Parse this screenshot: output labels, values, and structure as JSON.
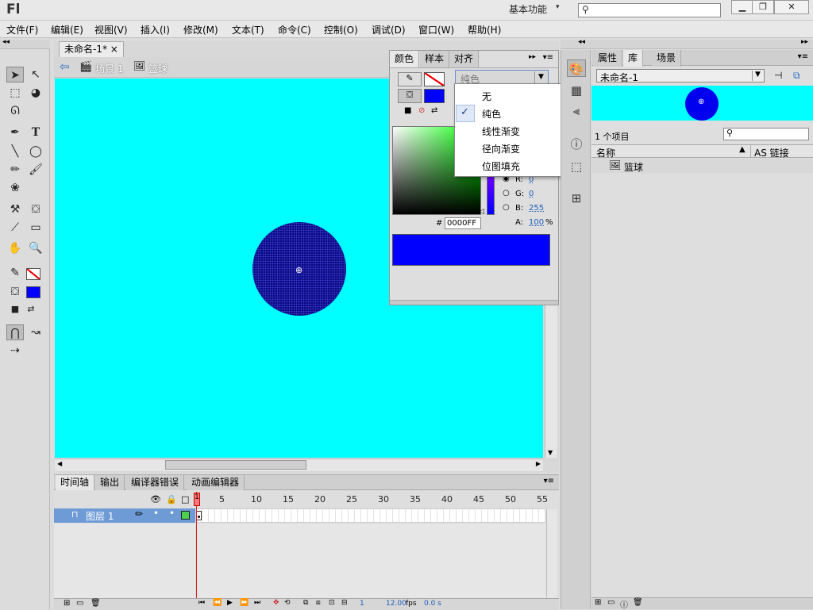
{
  "app": {
    "logo": "Fl",
    "workspace": "基本功能"
  },
  "menu": [
    "文件(F)",
    "编辑(E)",
    "视图(V)",
    "插入(I)",
    "修改(M)",
    "文本(T)",
    "命令(C)",
    "控制(O)",
    "调试(D)",
    "窗口(W)",
    "帮助(H)"
  ],
  "document": {
    "tab_label": "未命名-1*",
    "close": "×",
    "breadcrumb": {
      "scene": "场景 1",
      "symbol": "篮球"
    }
  },
  "color_panel": {
    "tabs": [
      "颜色",
      "样本",
      "对齐"
    ],
    "fill_type": "纯色",
    "dropdown_options": [
      "无",
      "纯色",
      "线性渐变",
      "径向渐变",
      "位图填充"
    ],
    "selected_option": "纯色",
    "fill_color": "#0000FF",
    "hex_label": "#",
    "hex_value": "0000FF",
    "r_label": "R:",
    "r_value": "0",
    "g_label": "G:",
    "g_value": "0",
    "b_label": "B:",
    "b_value": "255",
    "a_label": "A:",
    "a_value": "100",
    "a_unit": "%"
  },
  "library": {
    "tabs": [
      "属性",
      "库",
      "场景"
    ],
    "doc_select": "未命名-1",
    "item_count": "1 个项目",
    "col_name": "名称",
    "col_link": "AS 链接",
    "items": [
      "篮球"
    ]
  },
  "timeline": {
    "tabs": [
      "时间轴",
      "输出",
      "编译器错误",
      "动画编辑器"
    ],
    "layer_name": "图层 1",
    "frame_numbers": [
      "1",
      "5",
      "10",
      "15",
      "20",
      "25",
      "30",
      "35",
      "40",
      "45",
      "50",
      "55"
    ],
    "status_frame": "1",
    "status_fps": "12.00",
    "fps_unit": "fps",
    "status_time": "0.0 s"
  },
  "colors": {
    "stage": "#00ffff",
    "fill": "#0000ff",
    "circle": "#0a0a80"
  }
}
